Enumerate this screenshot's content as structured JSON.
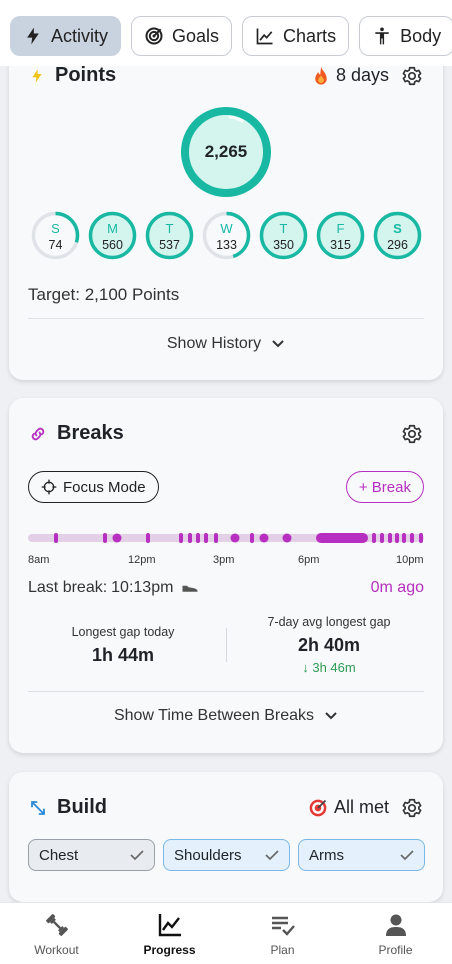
{
  "tabs": [
    {
      "label": "Activity",
      "icon": "bolt-icon",
      "active": true
    },
    {
      "label": "Goals",
      "icon": "target-icon",
      "active": false
    },
    {
      "label": "Charts",
      "icon": "line-chart-icon",
      "active": false
    },
    {
      "label": "Body",
      "icon": "person-icon",
      "active": false
    }
  ],
  "points": {
    "title": "Points",
    "streak": "8 days",
    "total": "2,265",
    "total_progress": 1.0,
    "days": [
      {
        "letter": "S",
        "value": "74",
        "progress": 0.3,
        "bold": false
      },
      {
        "letter": "M",
        "value": "560",
        "progress": 1.0,
        "bold": false
      },
      {
        "letter": "T",
        "value": "537",
        "progress": 1.0,
        "bold": false
      },
      {
        "letter": "W",
        "value": "133",
        "progress": 0.45,
        "bold": false
      },
      {
        "letter": "T",
        "value": "350",
        "progress": 1.0,
        "bold": false
      },
      {
        "letter": "F",
        "value": "315",
        "progress": 1.0,
        "bold": false
      },
      {
        "letter": "S",
        "value": "296",
        "progress": 1.0,
        "bold": true
      }
    ],
    "target": "Target: 2,100 Points",
    "show_history": "Show History"
  },
  "breaks": {
    "title": "Breaks",
    "focus_mode": "Focus Mode",
    "add_break": "+ Break",
    "timeline_labels": [
      "8am",
      "12pm",
      "3pm",
      "6pm",
      "10pm"
    ],
    "last_break_label": "Last break:",
    "last_break_time": "10:13pm",
    "ago": "0m ago",
    "longest_today_label": "Longest gap today",
    "longest_today_value": "1h 44m",
    "avg_label": "7-day avg longest gap",
    "avg_value": "2h 40m",
    "avg_delta": "↓ 3h 46m",
    "show_time": "Show Time Between Breaks"
  },
  "build": {
    "title": "Build",
    "status": "All met",
    "chips": [
      {
        "label": "Chest",
        "style": "gray"
      },
      {
        "label": "Shoulders",
        "style": "blue"
      },
      {
        "label": "Arms",
        "style": "blue"
      }
    ]
  },
  "nav": [
    {
      "label": "Workout",
      "icon": "dumbbell-icon",
      "active": false
    },
    {
      "label": "Progress",
      "icon": "chart-icon",
      "active": true
    },
    {
      "label": "Plan",
      "icon": "checklist-icon",
      "active": false
    },
    {
      "label": "Profile",
      "icon": "user-icon",
      "active": false
    }
  ],
  "colors": {
    "teal": "#18b8a3",
    "teal_light": "#d4f4ee",
    "purple": "#b62fc0",
    "purple_light": "#e3cfe6",
    "green": "#2e9c55"
  }
}
